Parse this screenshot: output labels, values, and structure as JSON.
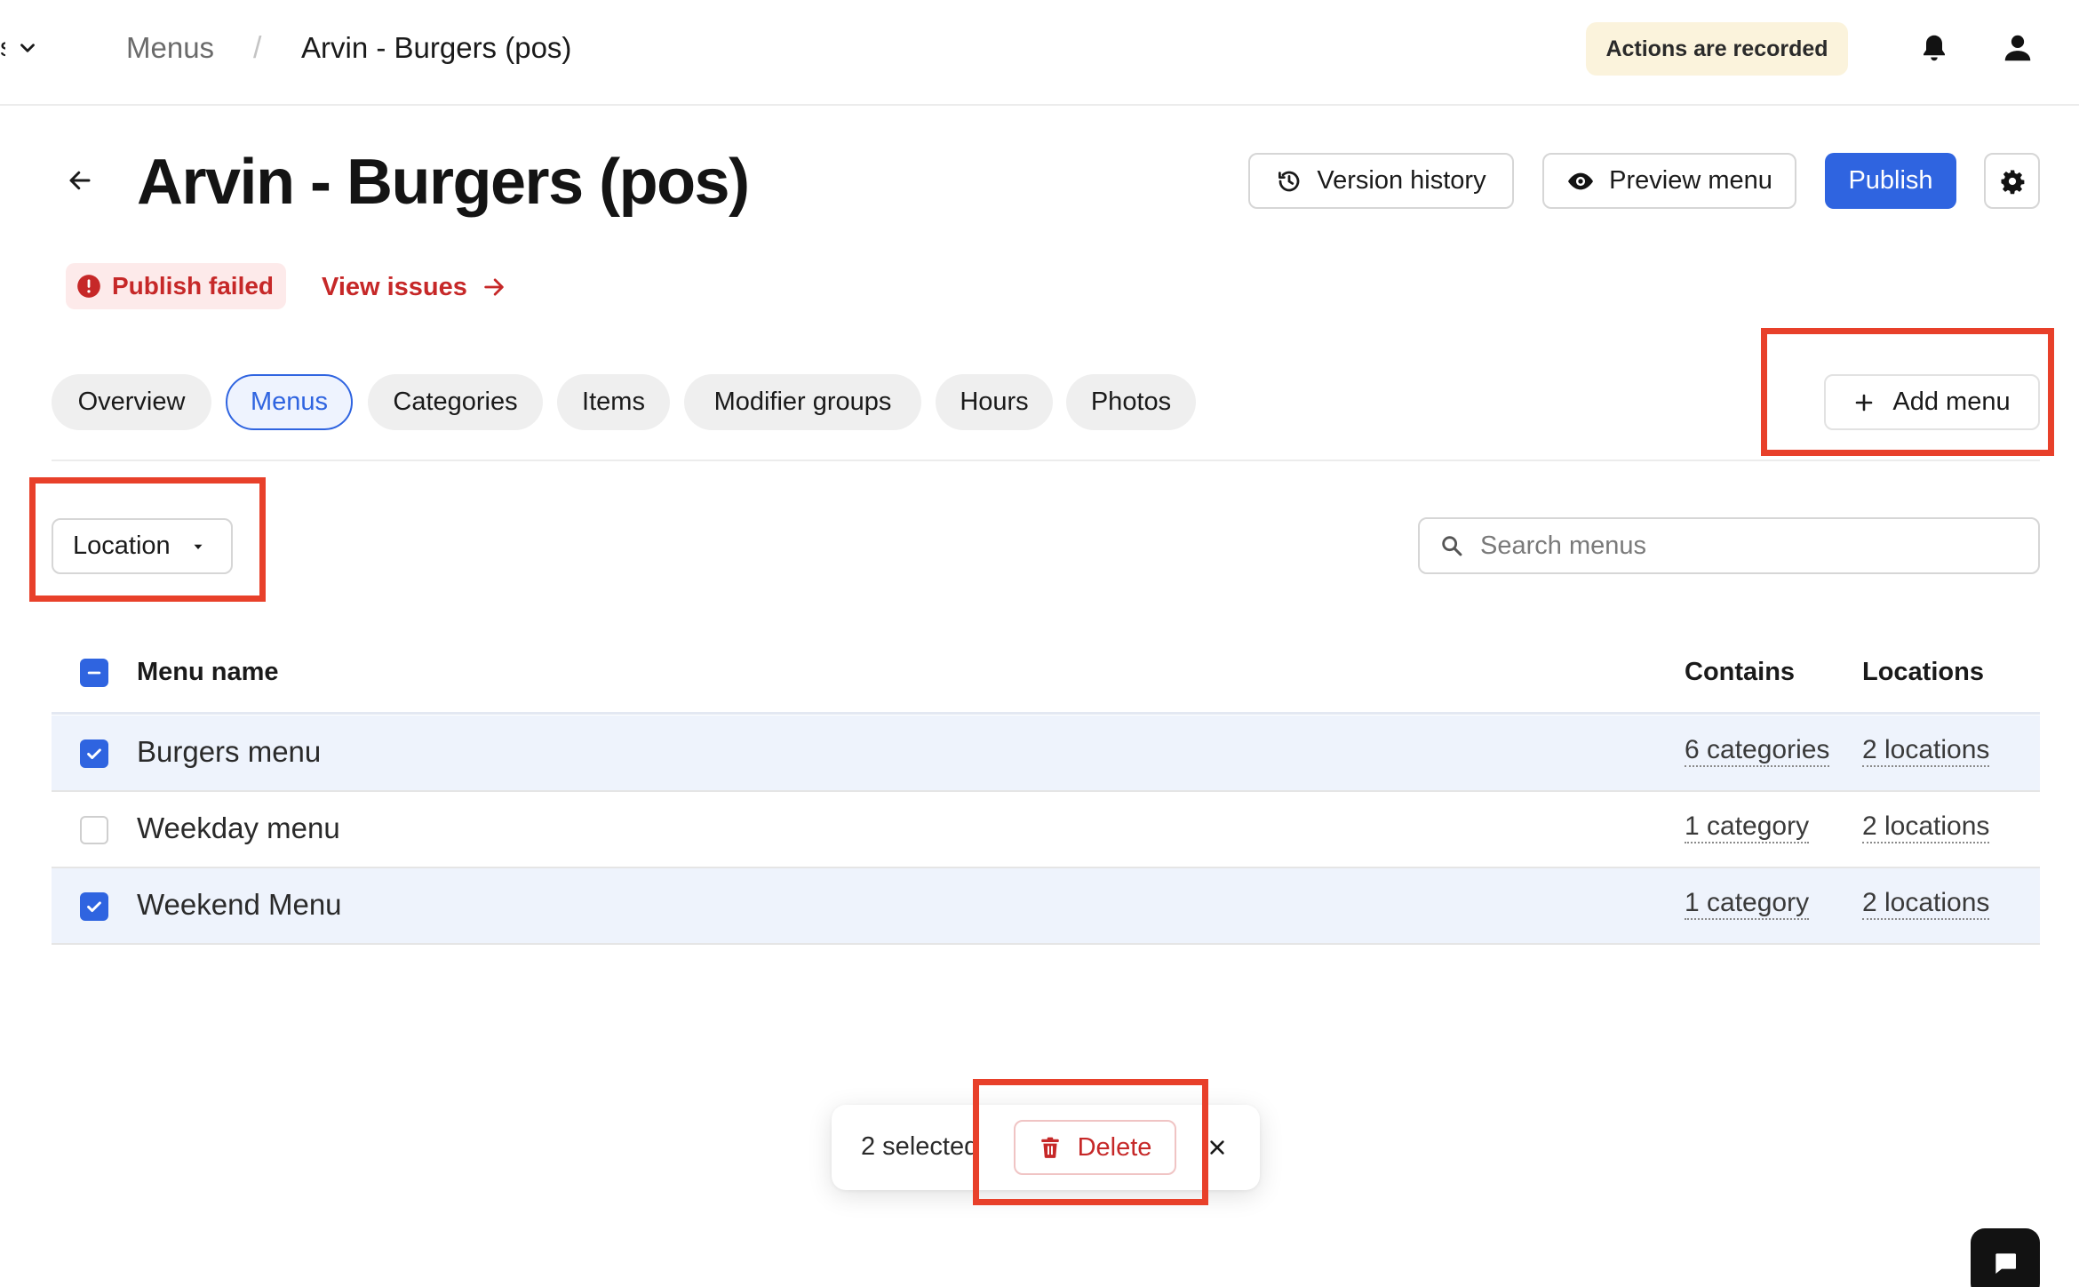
{
  "topbar": {
    "org_partial": "s",
    "breadcrumb_parent": "Menus",
    "breadcrumb_separator": "/",
    "breadcrumb_current": "Arvin - Burgers (pos)",
    "recorded_badge": "Actions are recorded"
  },
  "header": {
    "title": "Arvin - Burgers (pos)",
    "version_history_label": "Version history",
    "preview_menu_label": "Preview menu",
    "publish_label": "Publish"
  },
  "status": {
    "badge": "Publish failed",
    "link": "View issues"
  },
  "tabs": [
    {
      "label": "Overview"
    },
    {
      "label": "Menus",
      "active": true
    },
    {
      "label": "Categories"
    },
    {
      "label": "Items"
    },
    {
      "label": "Modifier groups"
    },
    {
      "label": "Hours"
    },
    {
      "label": "Photos"
    }
  ],
  "add_menu_label": "Add menu",
  "filters": {
    "location_label": "Location",
    "search_placeholder": "Search menus"
  },
  "table": {
    "columns": [
      "Menu name",
      "Contains",
      "Locations"
    ],
    "rows": [
      {
        "name": "Burgers menu",
        "contains": "6 categories",
        "locations": "2 locations",
        "selected": true
      },
      {
        "name": "Weekday menu",
        "contains": "1 category",
        "locations": "2 locations",
        "selected": false
      },
      {
        "name": "Weekend Menu",
        "contains": "1 category",
        "locations": "2 locations",
        "selected": true
      }
    ]
  },
  "bulk": {
    "count_text": "2 selected",
    "delete_label": "Delete"
  },
  "colors": {
    "accent": "#2f64e0",
    "danger": "#c62828",
    "highlight": "#e8402a",
    "selected_row": "#eef3fc"
  }
}
